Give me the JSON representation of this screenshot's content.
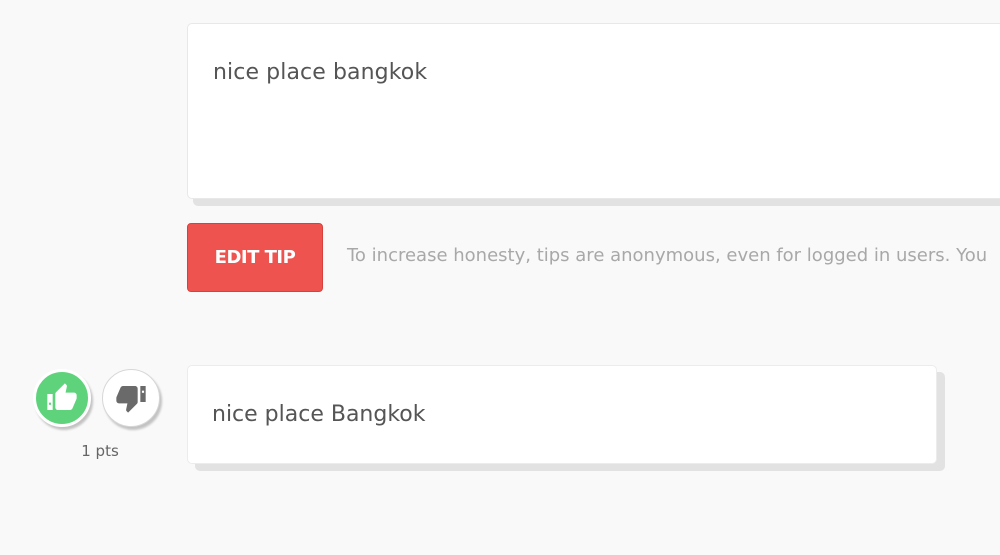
{
  "editor": {
    "text": "nice place bangkok"
  },
  "edit_button": {
    "label": "EDIT TIP"
  },
  "anonymity_note": "To increase honesty, tips are anonymous, even for logged in users. You",
  "tip": {
    "points": "1 pts",
    "text": "nice place Bangkok",
    "upvote_icon": "thumbs-up-icon",
    "downvote_icon": "thumbs-down-icon"
  },
  "colors": {
    "accent_red": "#ef5350",
    "upvote_green": "#5fd37c",
    "background": "#f9f9f9"
  }
}
